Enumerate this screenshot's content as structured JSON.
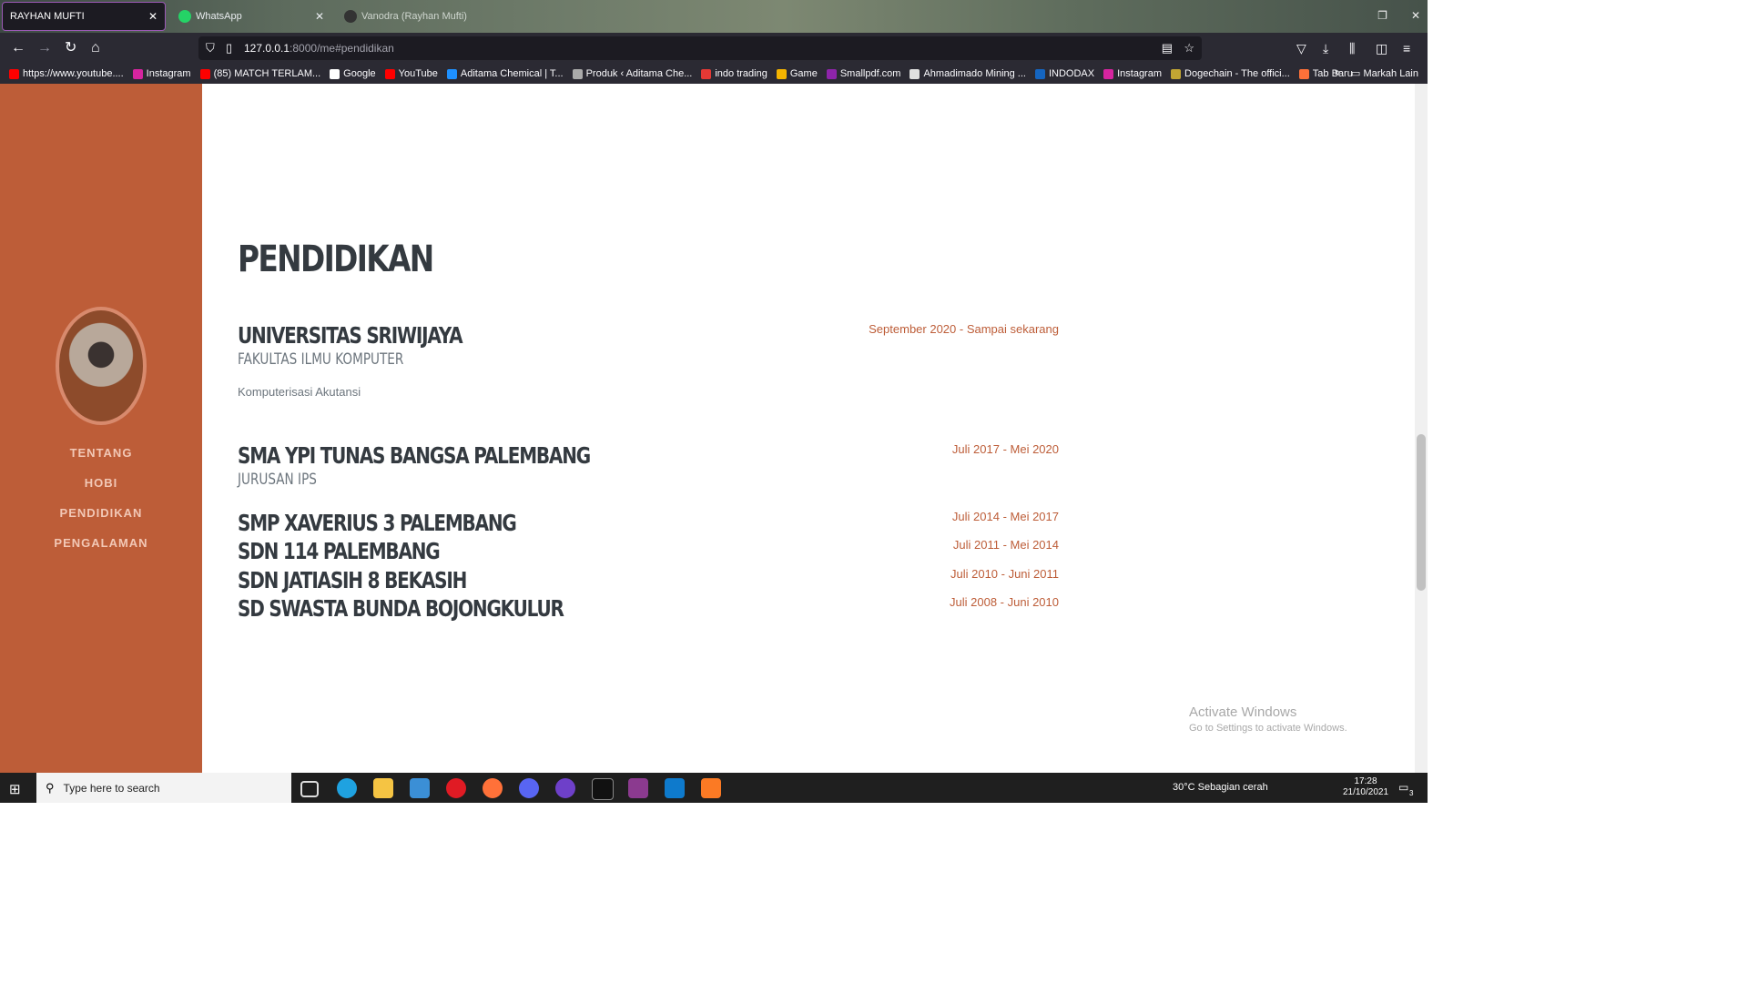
{
  "browser": {
    "tabs": [
      {
        "label": "RAYHAN MUFTI",
        "active": true
      },
      {
        "label": "WhatsApp",
        "active": false
      },
      {
        "label": "Vanodra (Rayhan Mufti)",
        "active": false
      }
    ],
    "url_host": "127.0.0.1",
    "url_rest": ":8000/me#pendidikan",
    "bookmarks": [
      {
        "label": "https://www.youtube....",
        "color": "#ff0000"
      },
      {
        "label": "Instagram",
        "color": "#d6249f"
      },
      {
        "label": "(85) MATCH TERLAM...",
        "color": "#ff0000"
      },
      {
        "label": "Google",
        "color": "#ffffff"
      },
      {
        "label": "YouTube",
        "color": "#ff0000"
      },
      {
        "label": "Aditama Chemical | T...",
        "color": "#1e90ff"
      },
      {
        "label": "Produk ‹ Aditama Che...",
        "color": "#aaaaaa"
      },
      {
        "label": "indo trading",
        "color": "#e53935"
      },
      {
        "label": "Game",
        "color": "#f4b400"
      },
      {
        "label": "Smallpdf.com",
        "color": "#8e24aa"
      },
      {
        "label": "Ahmadimado Mining ...",
        "color": "#e0e0e0"
      },
      {
        "label": "INDODAX",
        "color": "#1565c0"
      },
      {
        "label": "Instagram",
        "color": "#d6249f"
      },
      {
        "label": "Dogechain - The offici...",
        "color": "#c2a633"
      },
      {
        "label": "Tab Baru",
        "color": "#ff7139"
      }
    ],
    "bookmarks_other": "Markah Lain"
  },
  "sidebar": {
    "nav": [
      "TENTANG",
      "HOBI",
      "PENDIDIKAN",
      "PENGALAMAN"
    ]
  },
  "main": {
    "section_title": "PENDIDIKAN",
    "entries": [
      {
        "school": "UNIVERSITAS SRIWIJAYA",
        "sub": "FAKULTAS ILMU KOMPUTER",
        "desc": "Komputerisasi Akutansi",
        "date": "September 2020 - Sampai sekarang"
      },
      {
        "school": "SMA YPI TUNAS BANGSA PALEMBANG",
        "sub": "JURUSAN IPS",
        "date": "Juli 2017 - Mei 2020"
      },
      {
        "school": "SMP XAVERIUS 3 PALEMBANG",
        "date": "Juli 2014 - Mei 2017"
      },
      {
        "school": "SDN 114 PALEMBANG",
        "date": "Juli 2011 - Mei 2014"
      },
      {
        "school": "SDN JATIASIH 8 BEKASIH",
        "date": "Juli 2010 - Juni 2011"
      },
      {
        "school": "SD SWASTA BUNDA BOJONGKULUR",
        "date": "Juli 2008 - Juni 2010"
      }
    ]
  },
  "watermark": {
    "line1": "Activate Windows",
    "line2": "Go to Settings to activate Windows."
  },
  "taskbar": {
    "search_placeholder": "Type here to search",
    "weather": "30°C  Sebagian cerah",
    "time": "17:28",
    "date": "21/10/2021",
    "notifications": "3"
  },
  "colors": {
    "sidebar": "#bd5d38",
    "accent_text": "#bd5d38",
    "heading": "#343a40"
  }
}
